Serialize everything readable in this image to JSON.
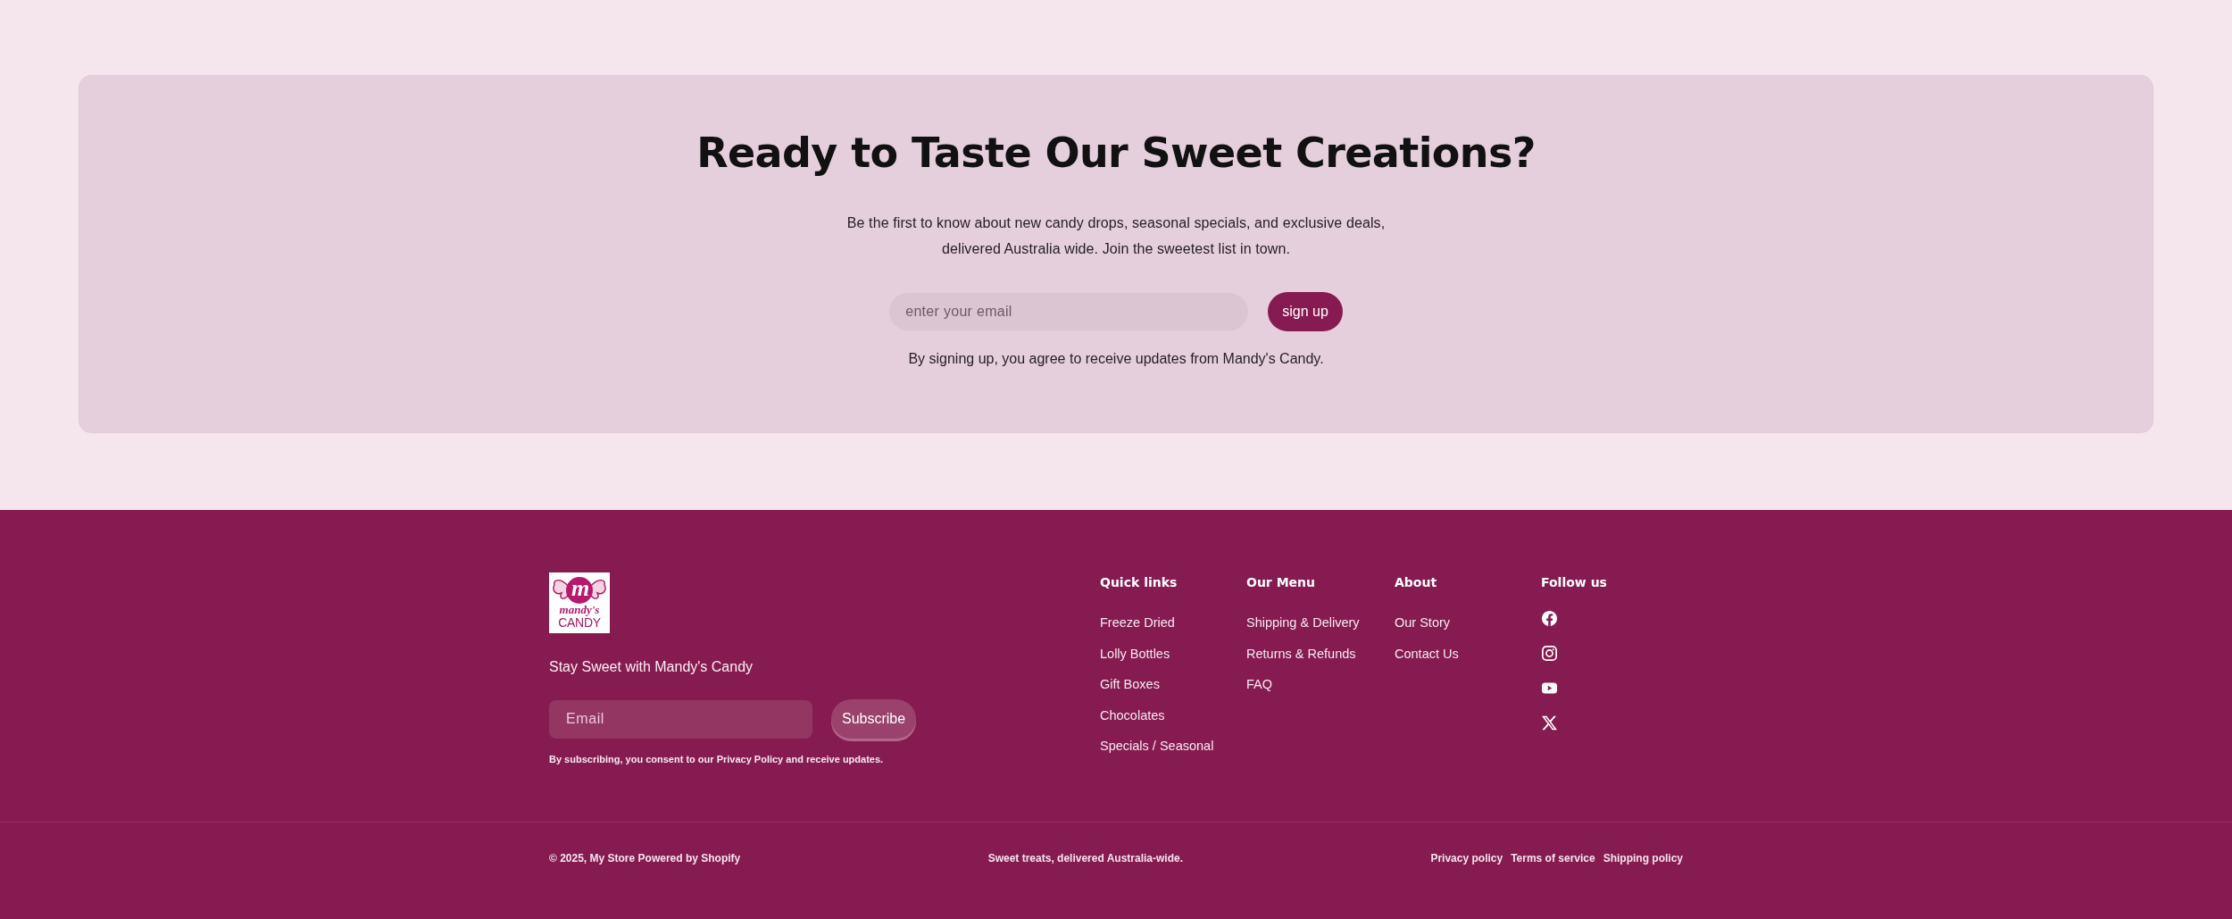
{
  "newsletter": {
    "heading": "Ready to Taste Our Sweet Creations?",
    "description": "Be the first to know about new candy drops, seasonal specials, and exclusive deals, delivered Australia wide. Join the sweetest list in town.",
    "email_field": {
      "placeholder": "enter your email"
    },
    "button": "sign up",
    "note": "By signing up, you agree to receive updates from Mandy's Candy."
  },
  "footer": {
    "logo": {
      "mark": "m",
      "name": "mandy's",
      "word": "CANDY"
    },
    "tagline": "Stay Sweet with Mandy's Candy",
    "email_field": {
      "placeholder": "Email"
    },
    "subscribe_button": "Subscribe",
    "consent": "By subscribing, you consent to our Privacy Policy and receive updates.",
    "columns": [
      {
        "title": "Quick links",
        "links": [
          "Freeze Dried",
          "Lolly Bottles",
          "Gift Boxes",
          "Chocolates",
          "Specials / Seasonal"
        ]
      },
      {
        "title": "Our Menu",
        "links": [
          "Shipping & Delivery",
          "Returns & Refunds",
          "FAQ"
        ]
      },
      {
        "title": "About",
        "links": [
          "Our Story",
          "Contact Us"
        ]
      }
    ],
    "social": {
      "title": "Follow us",
      "links": [
        {
          "kind": "facebook"
        },
        {
          "kind": "instagram"
        },
        {
          "kind": "youtube"
        },
        {
          "kind": "x"
        }
      ]
    }
  },
  "bottom_bar": {
    "copyright": "© 2025, My Store Powered by Shopify",
    "tagline": "Sweet treats, delivered Australia-wide.",
    "policies": [
      "Privacy policy",
      "Terms of service",
      "Shipping policy"
    ]
  }
}
